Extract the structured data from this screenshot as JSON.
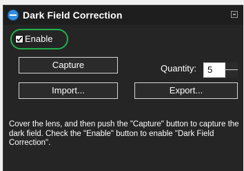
{
  "panel": {
    "title": "Dark Field Correction",
    "title_icon": "collapse-circle-icon"
  },
  "enable": {
    "label": "Enable",
    "checked": true
  },
  "buttons": {
    "capture": "Capture",
    "import": "Import...",
    "export": "Export..."
  },
  "quantity": {
    "label": "Quantity:",
    "value": "5"
  },
  "help": {
    "text": "Cover the lens, and then push the \"Capture\" button to capture the dark field. Check the \"Enable\" button to enable \"Dark Field Correction\"."
  },
  "colors": {
    "panel_bg": "#252525",
    "highlight": "#23b14d",
    "title_icon": "#2f8fe0"
  }
}
